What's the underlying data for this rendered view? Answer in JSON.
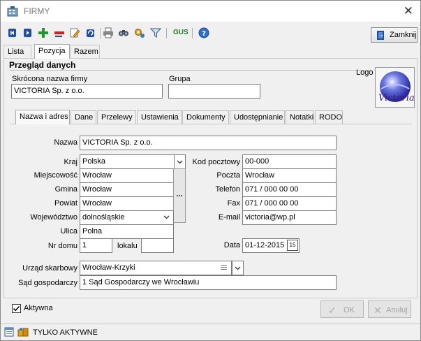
{
  "window": {
    "title": "FIRMY",
    "close_glyph": "✕"
  },
  "toolbar": {
    "icons": [
      "first-record-icon",
      "previous-record-icon",
      "add-record-icon",
      "delete-record-icon",
      "edit-record-icon",
      "refresh-icon",
      "print-icon",
      "search-icon",
      "filter-settings-icon",
      "filter-icon",
      "gus-icon",
      "help-icon"
    ],
    "gus_label": "GUS",
    "close_button_label": "Zamknij"
  },
  "main_tabs": [
    "Lista",
    "Pozycja",
    "Razem"
  ],
  "overview": {
    "title": "Przegląd danych",
    "short_name_label": "Skrócona nazwa firmy",
    "short_name_value": "VICTORIA Sp. z o.o.",
    "group_label": "Grupa",
    "group_value": "",
    "logo_label": "Logo",
    "logo_text": "Victoria"
  },
  "inner_tabs": [
    "Nazwa i adres",
    "Dane",
    "Przelewy",
    "Ustawienia",
    "Dokumenty",
    "Udostępnianie",
    "Notatki",
    "RODO"
  ],
  "form": {
    "nazwa_label": "Nazwa",
    "nazwa_value": "VICTORIA Sp. z o.o.",
    "kraj_label": "Kraj",
    "kraj_value": "Polska",
    "miejscowosc_label": "Miejscowość",
    "miejscowosc_value": "Wrocław",
    "gmina_label": "Gmina",
    "gmina_value": "Wrocław",
    "powiat_label": "Powiat",
    "powiat_value": "Wrocław",
    "wojewodztwo_label": "Województwo",
    "wojewodztwo_value": "dolnośląskie",
    "ulica_label": "Ulica",
    "ulica_value": "Polna",
    "nr_domu_label": "Nr domu",
    "nr_domu_value": "1",
    "lokalu_label": "lokalu",
    "lokalu_value": "",
    "kod_label": "Kod pocztowy",
    "kod_value": "00-000",
    "poczta_label": "Poczta",
    "poczta_value": "Wrocław",
    "telefon_label": "Telefon",
    "telefon_value": "071 / 000 00 00",
    "fax_label": "Fax",
    "fax_value": "071 / 000 00 00",
    "email_label": "E-mail",
    "email_value": "victoria@wp.pl",
    "data_label": "Data",
    "data_value": "01-12-2015",
    "calendar_label": "15",
    "urzad_label": "Urząd skarbowy",
    "urzad_value": "Wrocław-Krzyki",
    "sad_label": "Sąd gospodarczy",
    "sad_value": "1 Sąd Gospodarczy we Wrocławiu",
    "ellipsis": "..."
  },
  "footer": {
    "aktywna_label": "Aktywna",
    "aktywna_checked": true,
    "ok_label": "OK",
    "cancel_label": "Anuluj"
  },
  "statusbar": {
    "text": "TYLKO AKTYWNE"
  }
}
